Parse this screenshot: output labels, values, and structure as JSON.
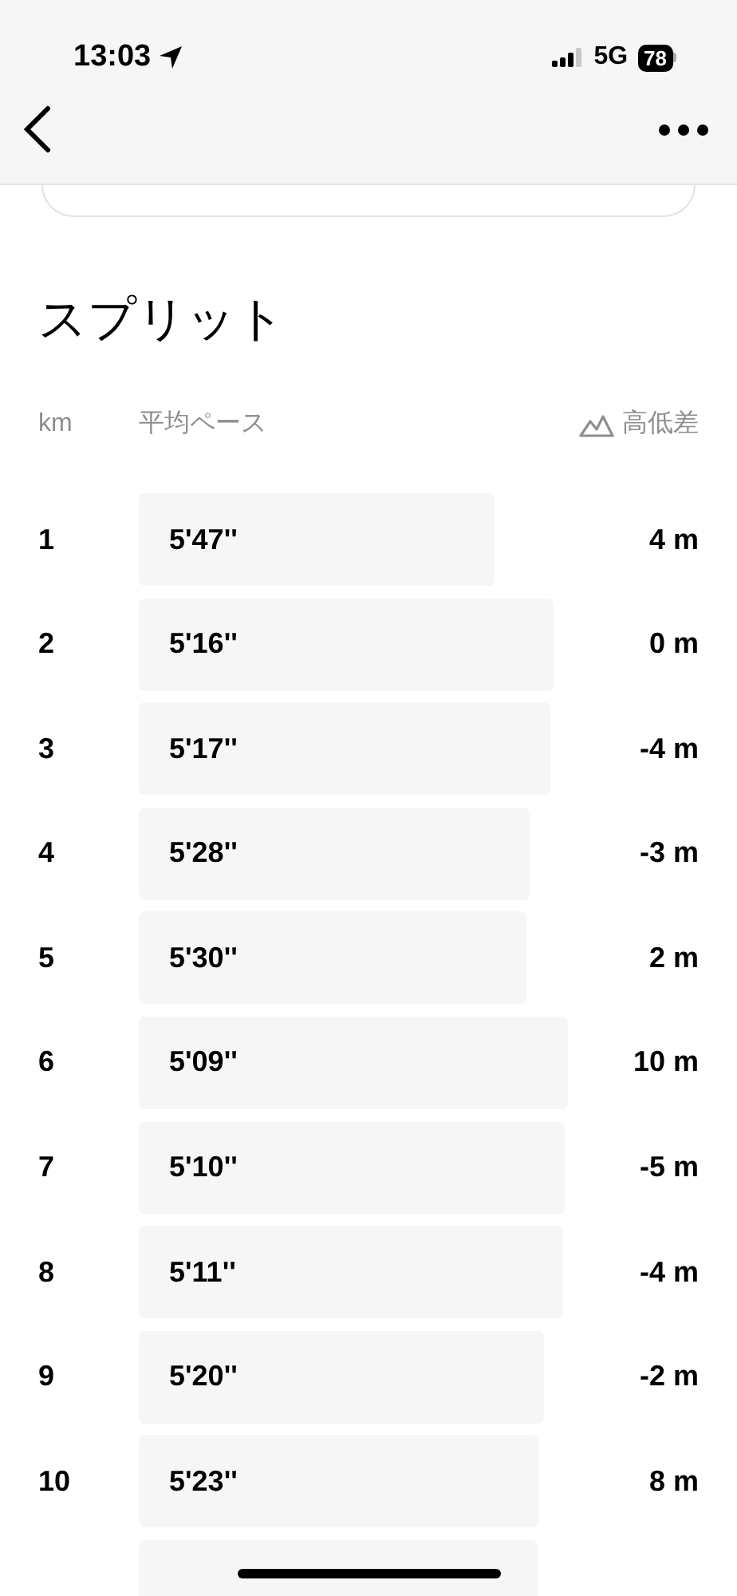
{
  "status_bar": {
    "time": "13:03",
    "network": "5G",
    "battery": "78"
  },
  "section_title": "スプリット",
  "columns": [
    "km",
    "平均ペース",
    "高低差"
  ],
  "splits": [
    {
      "km": "1",
      "pace": "5'47''",
      "elevation": "4 m"
    },
    {
      "km": "2",
      "pace": "5'16''",
      "elevation": "0 m"
    },
    {
      "km": "3",
      "pace": "5'17''",
      "elevation": "-4 m"
    },
    {
      "km": "4",
      "pace": "5'28''",
      "elevation": "-3 m"
    },
    {
      "km": "5",
      "pace": "5'30''",
      "elevation": "2 m"
    },
    {
      "km": "6",
      "pace": "5'09''",
      "elevation": "10 m"
    },
    {
      "km": "7",
      "pace": "5'10''",
      "elevation": "-5 m"
    },
    {
      "km": "8",
      "pace": "5'11''",
      "elevation": "-4 m"
    },
    {
      "km": "9",
      "pace": "5'20''",
      "elevation": "-2 m"
    },
    {
      "km": "10",
      "pace": "5'23''",
      "elevation": "8 m"
    }
  ]
}
